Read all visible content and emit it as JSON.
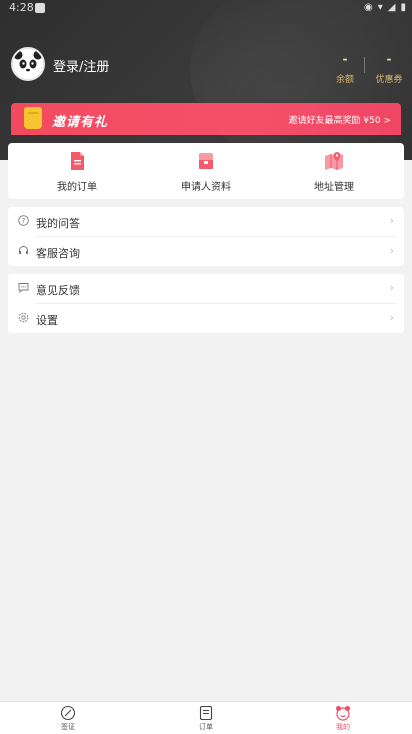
{
  "status_bar": {
    "time": "4:28"
  },
  "profile": {
    "login_label": "登录/注册"
  },
  "stats": [
    {
      "value": "-",
      "label": "余额"
    },
    {
      "value": "-",
      "label": "优惠券"
    }
  ],
  "invite_banner": {
    "title": "邀请有礼",
    "reward_text": "邀请好友最高奖励 ¥50 >"
  },
  "quick_actions": [
    {
      "label": "我的订单",
      "icon": "order-icon"
    },
    {
      "label": "申请人资料",
      "icon": "applicant-info-icon"
    },
    {
      "label": "地址管理",
      "icon": "map-icon"
    }
  ],
  "menu_group_1": [
    {
      "label": "我的问答",
      "icon": "question-icon"
    },
    {
      "label": "客服咨询",
      "icon": "headset-icon"
    }
  ],
  "menu_group_2": [
    {
      "label": "意见反馈",
      "icon": "feedback-icon"
    },
    {
      "label": "设置",
      "icon": "gear-icon"
    }
  ],
  "tab_bar": [
    {
      "label": "签证",
      "icon": "visa-icon",
      "active": false
    },
    {
      "label": "订单",
      "icon": "orders-tab-icon",
      "active": false
    },
    {
      "label": "我的",
      "icon": "my-tab-icon",
      "active": true
    }
  ],
  "colors": {
    "accent": "#f04b66",
    "gold": "#d8b56a",
    "header_bg": "#333333"
  }
}
